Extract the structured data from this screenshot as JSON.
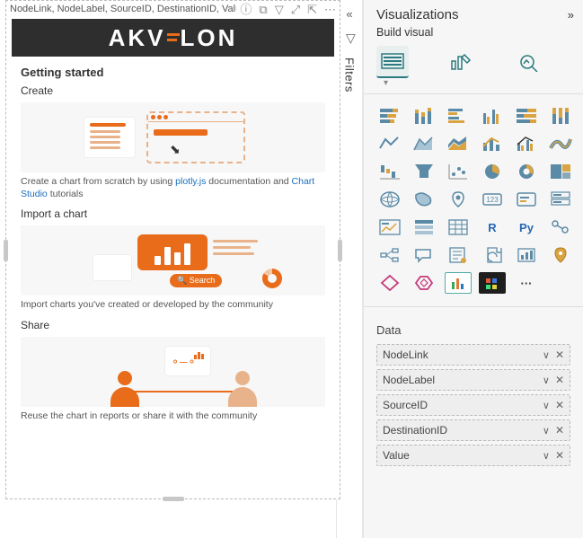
{
  "visualHeader": {
    "title": "NodeLink, NodeLabel, SourceID, DestinationID, Value"
  },
  "gettingStarted": {
    "title": "Getting started",
    "create": {
      "label": "Create",
      "text_prefix": "Create a chart from scratch by using ",
      "link1": "plotly.js",
      "text_mid": " documentation and ",
      "link2": "Chart Studio",
      "text_suffix": " tutorials"
    },
    "import": {
      "label": "Import a chart",
      "text": "Import charts you've created or developed by the community",
      "searchPill": "🔍 Search"
    },
    "share": {
      "label": "Share",
      "text": "Reuse the chart in reports or share it with the community"
    }
  },
  "filters": {
    "label": "Filters"
  },
  "vizPane": {
    "title": "Visualizations",
    "subtitle": "Build visual",
    "dataLabel": "Data",
    "fields": [
      {
        "name": "NodeLink"
      },
      {
        "name": "NodeLabel"
      },
      {
        "name": "SourceID"
      },
      {
        "name": "DestinationID"
      },
      {
        "name": "Value"
      }
    ],
    "rText": "R",
    "pyText": "Py",
    "num123": "123",
    "ellipsis": "···"
  }
}
